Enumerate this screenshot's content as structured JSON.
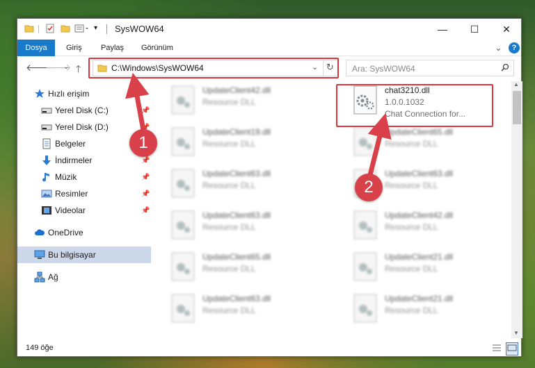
{
  "window": {
    "title": "SysWOW64",
    "controls": {
      "minimize": "—",
      "maximize": "☐",
      "close": "✕"
    }
  },
  "ribbon": {
    "tabs": [
      "Dosya",
      "Giriş",
      "Paylaş",
      "Görünüm"
    ],
    "expand_glyph": "⌄",
    "help_glyph": "?"
  },
  "address": {
    "path": "C:\\Windows\\SysWOW64",
    "search_placeholder": "Ara: SysWOW64"
  },
  "sidebar": {
    "items": [
      {
        "label": "Hızlı erişim",
        "icon": "star-icon",
        "pinned": false
      },
      {
        "label": "Yerel Disk (C:)",
        "icon": "drive-icon",
        "pinned": true
      },
      {
        "label": "Yerel Disk (D:)",
        "icon": "drive-icon",
        "pinned": true
      },
      {
        "label": "Belgeler",
        "icon": "document-icon",
        "pinned": true
      },
      {
        "label": "İndirmeler",
        "icon": "download-icon",
        "pinned": true
      },
      {
        "label": "Müzik",
        "icon": "music-icon",
        "pinned": true
      },
      {
        "label": "Resimler",
        "icon": "picture-icon",
        "pinned": true
      },
      {
        "label": "Videolar",
        "icon": "video-icon",
        "pinned": true
      },
      {
        "label": "OneDrive",
        "icon": "cloud-icon",
        "pinned": false
      },
      {
        "label": "Bu bilgisayar",
        "icon": "computer-icon",
        "pinned": false,
        "selected": true
      },
      {
        "label": "Ağ",
        "icon": "network-icon",
        "pinned": false
      }
    ],
    "pin_glyph": "📌"
  },
  "files": {
    "left_column": [
      {
        "name": "UpdateClient42.dll",
        "type": "Resource DLL"
      },
      {
        "name": "UpdateClient19.dll",
        "type": "Resource DLL"
      },
      {
        "name": "UpdateClient63.dll",
        "type": "Resource DLL"
      },
      {
        "name": "UpdateClient63.dll",
        "type": "Resource DLL"
      },
      {
        "name": "UpdateClient65.dll",
        "type": "Resource DLL"
      },
      {
        "name": "UpdateClient63.dll",
        "type": "Resource DLL"
      }
    ],
    "right_column": [
      {
        "name": "chat3210.dll",
        "version": "1.0.0.1032",
        "description": "Chat Connection for..."
      },
      {
        "name": "UpdateClient65.dll",
        "type": "Resource DLL"
      },
      {
        "name": "UpdateClient63.dll",
        "type": "Resource DLL"
      },
      {
        "name": "UpdateClient42.dll",
        "type": "Resource DLL"
      },
      {
        "name": "UpdateClient21.dll",
        "type": "Resource DLL"
      },
      {
        "name": "UpdateClient21.dll",
        "type": "Resource DLL"
      }
    ]
  },
  "status": {
    "item_count": "149 öğe"
  },
  "annotations": {
    "marker1": "1",
    "marker2": "2",
    "highlight_color": "#d9363e"
  },
  "colors": {
    "file_tab": "#1979ca",
    "selection": "#ccd8ea",
    "accent_red": "#d9404a"
  }
}
